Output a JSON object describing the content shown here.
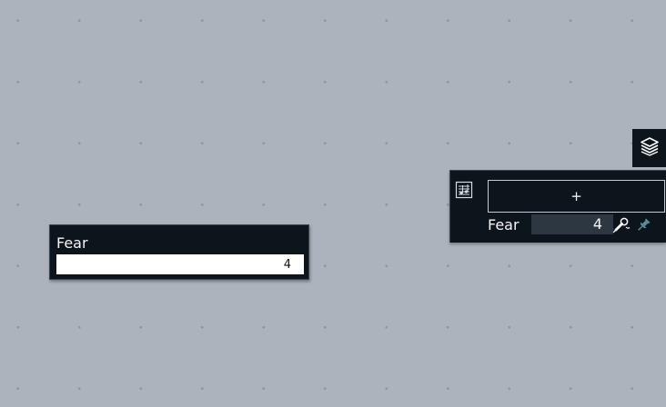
{
  "canvas_node": {
    "label": "Fear",
    "value": "4"
  },
  "toolbar": {
    "layers_icon": "layers-icon"
  },
  "panel": {
    "notes_icon": "music-notes-icon",
    "add_label": "+",
    "row": {
      "label": "Fear",
      "value": "4",
      "mic_icon": "microphone-icon",
      "pin_icon": "pin-icon"
    }
  },
  "colors": {
    "canvas_bg": "#adb3bc",
    "dot": "#8e959f",
    "panel_bg": "#0c141c",
    "pin_accent": "#5b8f94"
  }
}
